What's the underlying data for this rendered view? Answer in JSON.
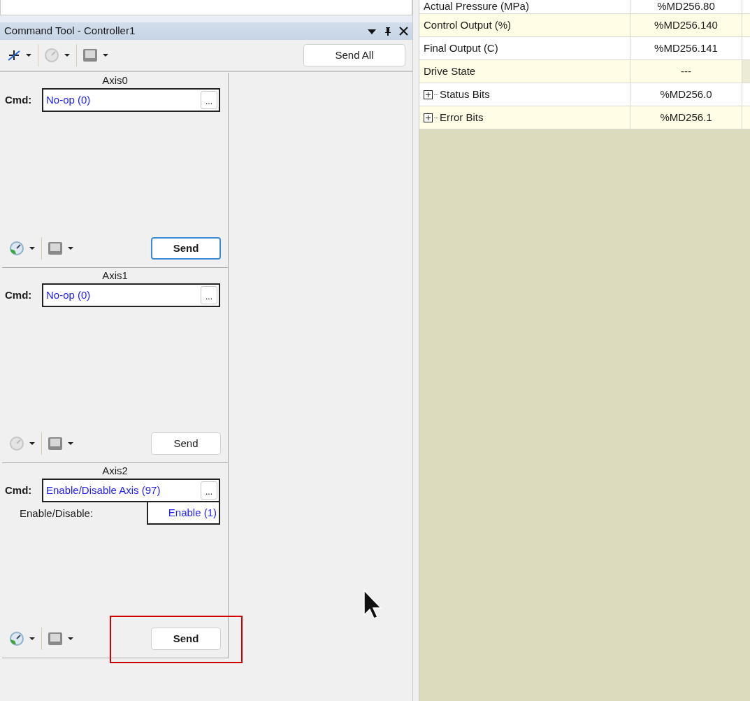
{
  "panel": {
    "title": "Command Tool - Controller1",
    "send_all": "Send All"
  },
  "axes": [
    {
      "name": "Axis0",
      "cmd_label": "Cmd:",
      "cmd": "No-op (0)",
      "browse": "...",
      "status_icon_enabled": true,
      "send": "Send",
      "send_emphasized": true,
      "send_focused": true,
      "highlighted": false
    },
    {
      "name": "Axis1",
      "cmd_label": "Cmd:",
      "cmd": "No-op (0)",
      "browse": "...",
      "status_icon_enabled": false,
      "send": "Send",
      "send_emphasized": false,
      "send_focused": false,
      "highlighted": false
    },
    {
      "name": "Axis2",
      "cmd_label": "Cmd:",
      "cmd": "Enable/Disable Axis (97)",
      "browse": "...",
      "params": [
        {
          "label": "Enable/Disable:",
          "value": "Enable (1)"
        }
      ],
      "status_icon_enabled": true,
      "send": "Send",
      "send_emphasized": true,
      "send_focused": false,
      "highlighted": true
    }
  ],
  "table": {
    "rows": [
      {
        "name": "Actual Pressure (MPa)",
        "address": "%MD256.80",
        "expandable": false
      },
      {
        "name": "Control Output (%)",
        "address": "%MD256.140",
        "expandable": false
      },
      {
        "name": "Final Output (C)",
        "address": "%MD256.141",
        "expandable": false
      },
      {
        "name": "Drive State",
        "address": "---",
        "expandable": false
      },
      {
        "name": "Status Bits",
        "address": "%MD256.0",
        "expandable": true
      },
      {
        "name": "Error Bits",
        "address": "%MD256.1",
        "expandable": true
      }
    ]
  }
}
